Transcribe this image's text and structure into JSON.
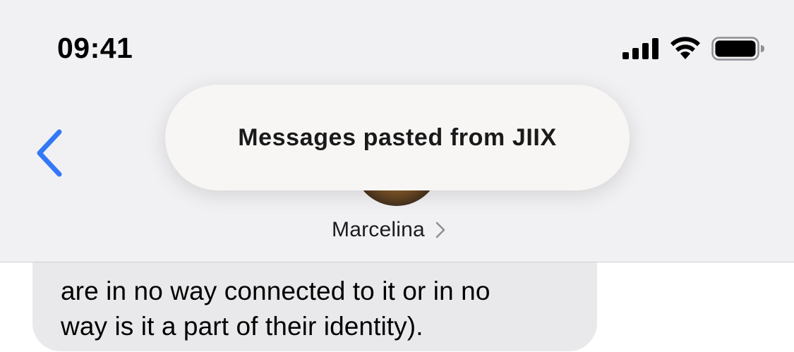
{
  "status_bar": {
    "time": "09:41",
    "icons": [
      "cellular-signal-icon",
      "wifi-icon",
      "battery-icon"
    ]
  },
  "header": {
    "back_icon": "chevron-left-icon",
    "contact_name": "Marcelina",
    "contact_chevron": "chevron-right-icon"
  },
  "toast": {
    "text": "Messages pasted from JIIX"
  },
  "conversation": {
    "bubble_lines": [
      "are in no way connected to it or in no",
      "way is it a part of their identity)."
    ]
  },
  "colors": {
    "accent": "#3478f6",
    "header_bg": "#f1f1f3",
    "bubble_bg": "#e9e9eb"
  }
}
